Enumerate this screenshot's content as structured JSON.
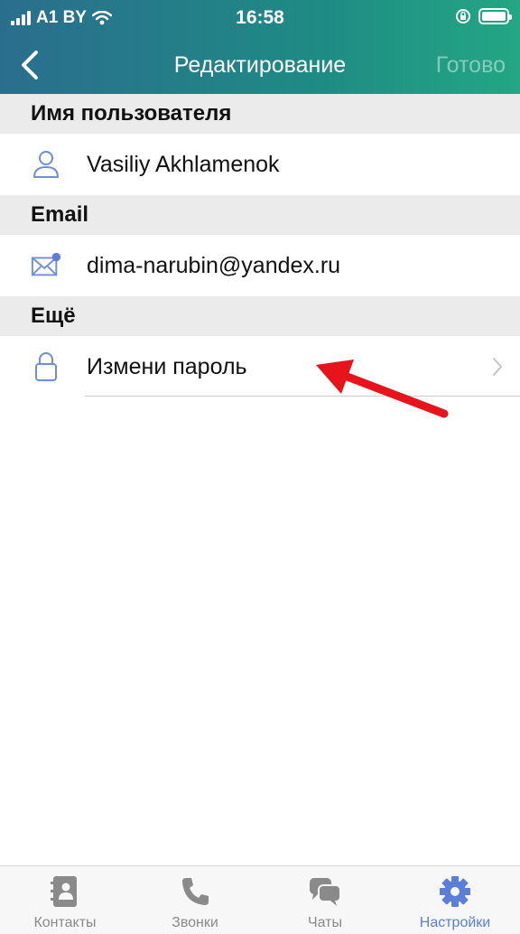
{
  "status_bar": {
    "carrier": "A1 BY",
    "time": "16:58"
  },
  "nav": {
    "title": "Редактирование",
    "done_label": "Готово"
  },
  "sections": {
    "username": {
      "header": "Имя пользователя",
      "value": "Vasiliy Akhlamenok",
      "icon": "user-icon"
    },
    "email": {
      "header": "Email",
      "value": "dima-narubin@yandex.ru",
      "icon": "mail-icon"
    },
    "more": {
      "header": "Ещё",
      "item_label": "Измени пароль",
      "icon": "lock-icon"
    }
  },
  "tabbar": {
    "items": [
      {
        "label": "Контакты",
        "icon": "contacts-book-icon"
      },
      {
        "label": "Звонки",
        "icon": "phone-icon"
      },
      {
        "label": "Чаты",
        "icon": "chat-bubbles-icon"
      },
      {
        "label": "Настройки",
        "icon": "gear-icon",
        "active": true
      }
    ]
  },
  "colors": {
    "accent": "#5b7fd6",
    "header_start": "#2a6e8e",
    "header_end": "#23a784",
    "annotation_arrow": "#e8141c"
  }
}
